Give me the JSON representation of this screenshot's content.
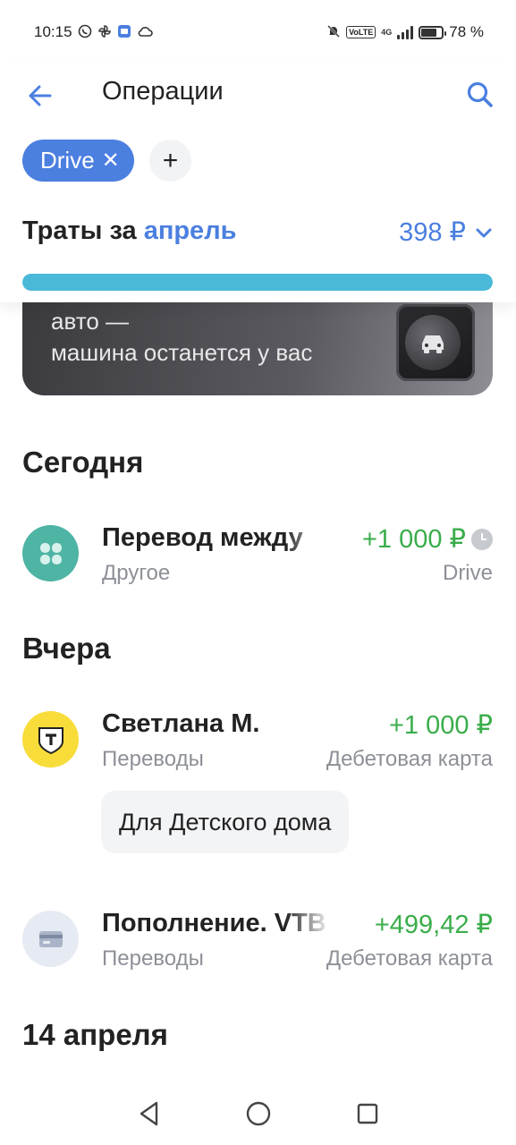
{
  "status_bar": {
    "time": "10:15",
    "network": "4G",
    "volte": "VoLTE",
    "battery": "78 %",
    "battery_level": 0.78,
    "left_icons": [
      "whatsapp-icon",
      "pinwheel-icon",
      "app-icon",
      "cloud-icon"
    ],
    "right_icons": [
      "mute-bell-icon",
      "volte-icon",
      "signal-icon",
      "battery-icon"
    ]
  },
  "header": {
    "title": "Операции",
    "back_icon": "arrow-left-icon",
    "search_icon": "search-icon"
  },
  "filters": {
    "active_chip": "Drive",
    "close_glyph": "✕",
    "add_glyph": "+"
  },
  "spending": {
    "label": "Траты за",
    "month": "апрель",
    "amount": "398 ₽",
    "progress": 1.0
  },
  "banner": {
    "line1": "авто —",
    "line2": "машина останется у вас"
  },
  "sections": {
    "today": "Сегодня",
    "yesterday": "Вчера",
    "april14": "14 апреля"
  },
  "operations": [
    {
      "name": "Перевод между",
      "category": "Другое",
      "amount": "+1 000 ₽",
      "account": "Drive",
      "icon": "clover-icon",
      "pending": true
    },
    {
      "name": "Светлана М.",
      "category": "Переводы",
      "amount": "+1 000 ₽",
      "account": "Дебетовая карта",
      "icon": "tbank-icon",
      "comment": "Для Детского дома"
    },
    {
      "name": "Пополнение. VTB",
      "category": "Переводы",
      "amount": "+499,42 ₽",
      "account": "Дебетовая карта",
      "icon": "card-icon"
    }
  ],
  "colors": {
    "accent": "#4b7fe0",
    "positive": "#3aad4a",
    "progress": "#4ab8d8",
    "muted": "#8d9097"
  }
}
